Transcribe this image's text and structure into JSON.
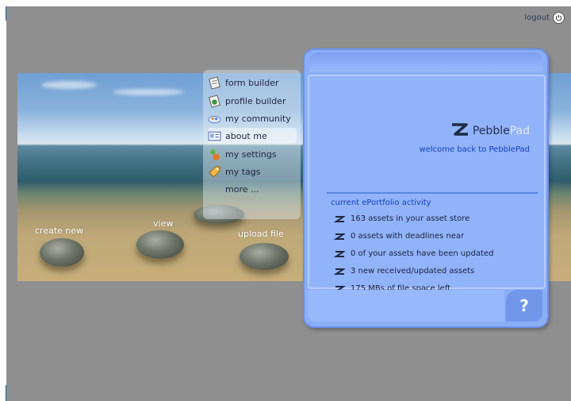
{
  "header": {
    "logout_label": "logout"
  },
  "scene": {
    "create_new_label": "create new",
    "view_label": "view",
    "upload_file_label": "upload file"
  },
  "menu": {
    "items": [
      {
        "label": "form builder",
        "icon": "form-icon"
      },
      {
        "label": "profile builder",
        "icon": "profile-icon"
      },
      {
        "label": "my community",
        "icon": "community-icon"
      },
      {
        "label": "about me",
        "icon": "id-card-icon"
      },
      {
        "label": "my settings",
        "icon": "settings-icon"
      },
      {
        "label": "my tags",
        "icon": "tag-icon"
      },
      {
        "label": "more ...",
        "icon": ""
      }
    ]
  },
  "panel": {
    "brand": "Pebble",
    "brand_suffix": "Pad",
    "welcome": "welcome back to PebblePad",
    "activity_title": "current ePortfolio activity",
    "activities": [
      "163 assets in your asset store",
      "0 assets with deadlines near",
      "0 of your assets have been updated",
      "3 new received/updated assets",
      "175 MBs of file space left"
    ],
    "help_label": "?"
  },
  "colors": {
    "panel": "#8aaef6",
    "accent_text": "#1540c0",
    "background": "#8f8f8f"
  }
}
